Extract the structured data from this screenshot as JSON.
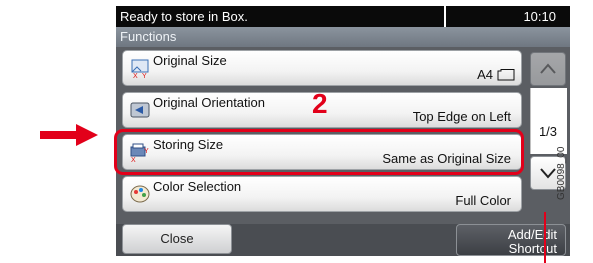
{
  "status": {
    "message": "Ready to store in Box.",
    "time": "10:10"
  },
  "functions_title": "Functions",
  "items": [
    {
      "label": "Original Size",
      "value": "A4",
      "icon": "original-size-icon"
    },
    {
      "label": "Original Orientation",
      "value": "Top Edge on Left",
      "icon": "orientation-icon"
    },
    {
      "label": "Storing Size",
      "value": "Same as Original Size",
      "icon": "storing-size-icon"
    },
    {
      "label": "Color Selection",
      "value": "Full Color",
      "icon": "color-selection-icon"
    }
  ],
  "page_indicator": "1/3",
  "callout_number": "2",
  "buttons": {
    "close": "Close",
    "shortcut_line1": "Add/Edit",
    "shortcut_line2": "Shortcut"
  },
  "figure_code": "GB0098_00",
  "colors": {
    "highlight": "#e2001a",
    "statusbar": "#0a0a0a",
    "panel": "#5b5e63"
  }
}
